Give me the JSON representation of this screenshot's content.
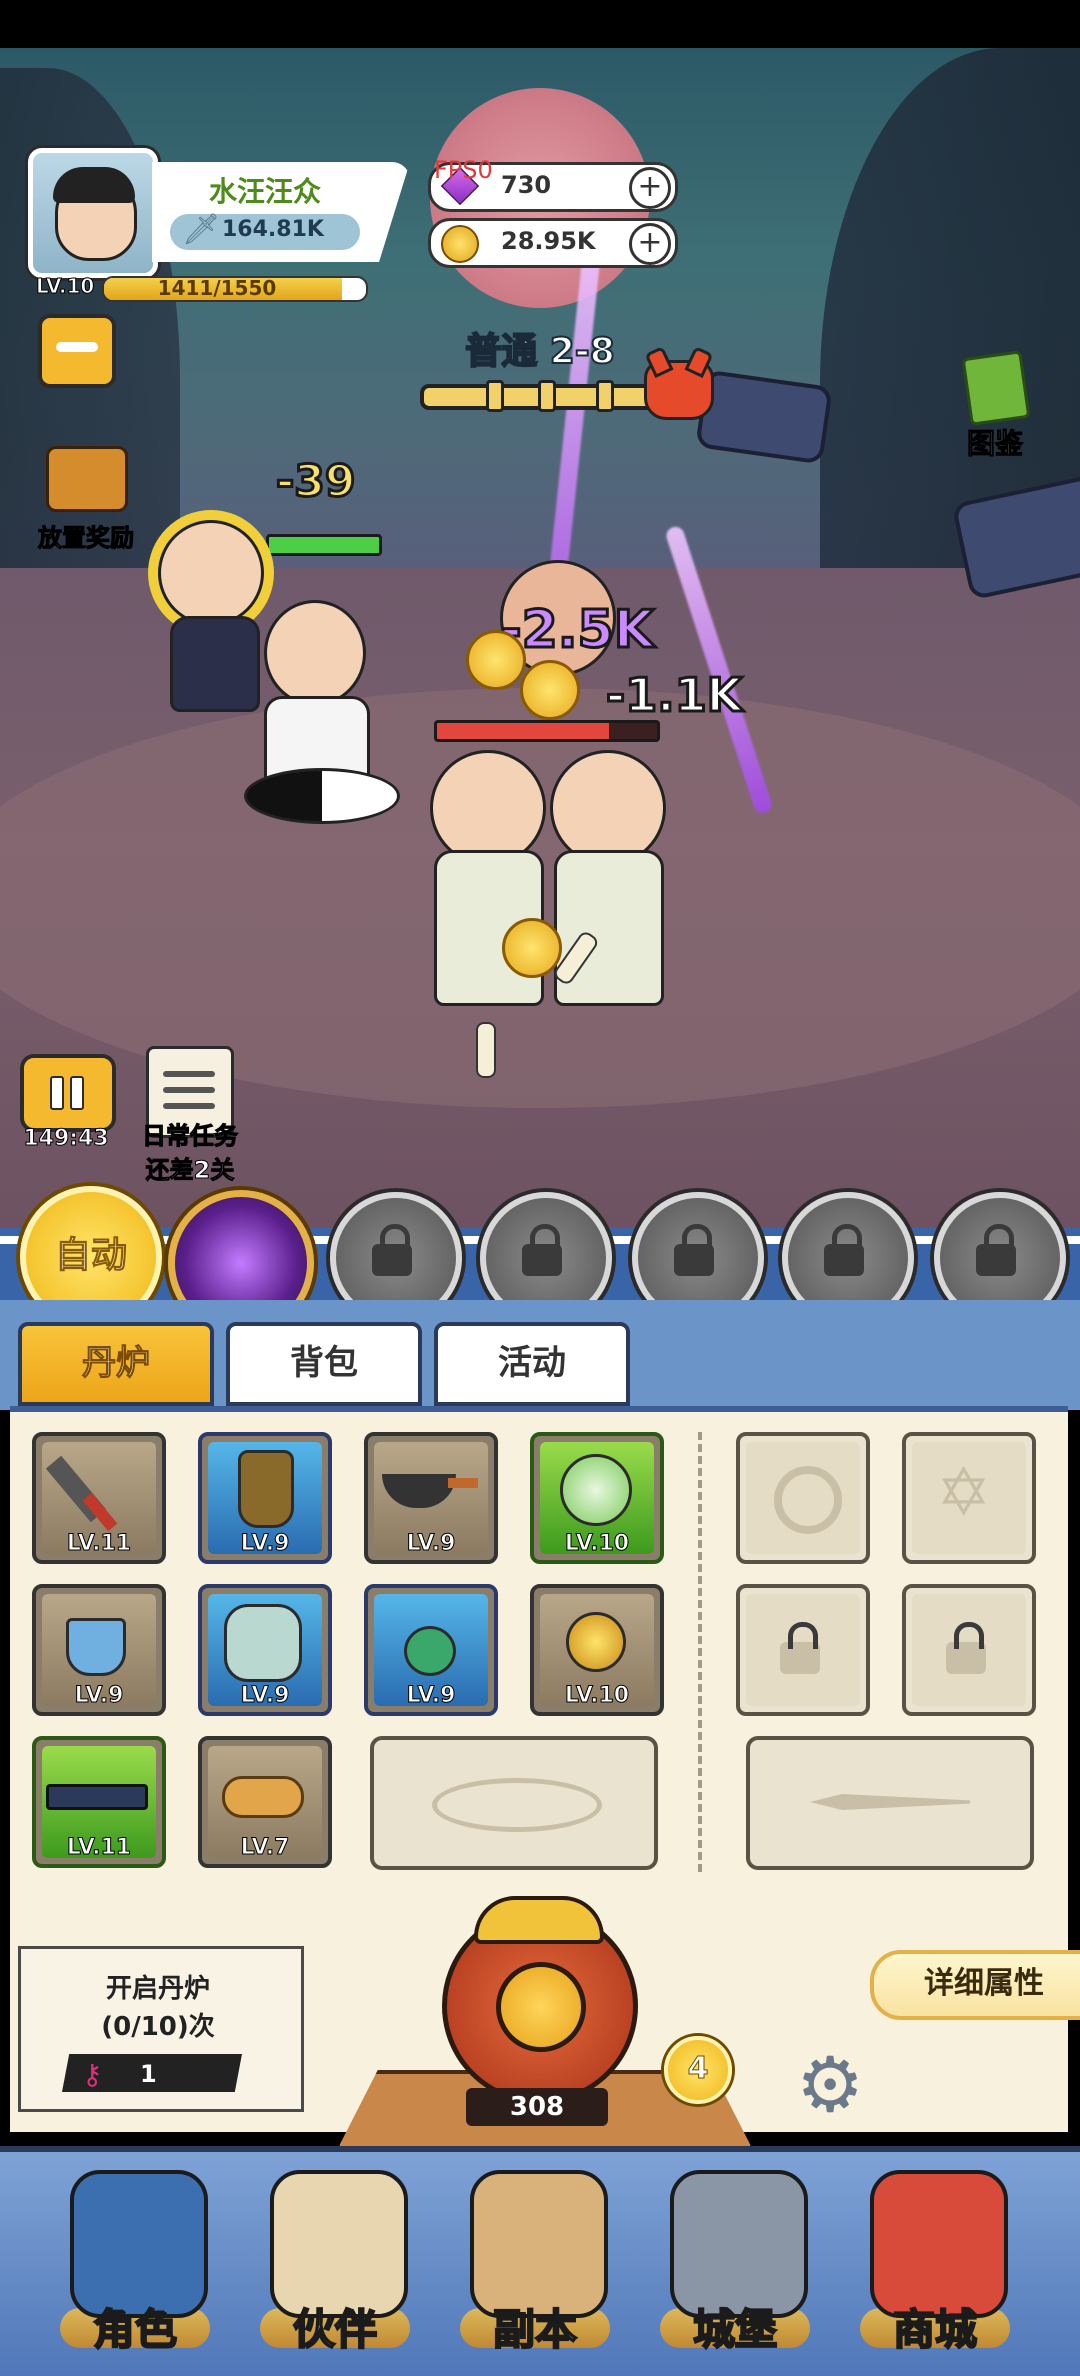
{
  "player": {
    "name": "水汪汪众",
    "power": "164.81K",
    "level": "LV.10",
    "exp": "1411/1550",
    "exp_fraction": 0.91
  },
  "resources": {
    "gems": "730",
    "coins": "28.95K",
    "fps_label": "FPS0"
  },
  "stage": {
    "title": "普通 2-8"
  },
  "side_buttons": {
    "idle_reward": "放置奖励",
    "codex": "图鉴",
    "timer": "149:43",
    "daily_task": "日常任务",
    "daily_task_sub": "还差2关"
  },
  "battle": {
    "damage_player": "-39",
    "damage_big": "-2.5K",
    "damage_enemy": "-1.1K",
    "player_hp_fraction": 1.0,
    "enemy_hp_fraction": 0.78
  },
  "skills": {
    "auto_label": "自动"
  },
  "tabs": [
    {
      "label": "丹炉",
      "active": true
    },
    {
      "label": "背包",
      "active": false
    },
    {
      "label": "活动",
      "active": false
    }
  ],
  "equipment": [
    {
      "level": "LV.11",
      "icon": "spatula-icon",
      "rarity": "brown"
    },
    {
      "level": "LV.9",
      "icon": "armor-icon",
      "rarity": "blue"
    },
    {
      "level": "LV.9",
      "icon": "wok-icon",
      "rarity": "brown"
    },
    {
      "level": "LV.10",
      "icon": "spirit-orb-icon",
      "rarity": "green"
    },
    {
      "level": "LV.9",
      "icon": "teacup-icon",
      "rarity": "brown"
    },
    {
      "level": "LV.9",
      "icon": "jade-disc-icon",
      "rarity": "blue"
    },
    {
      "level": "LV.9",
      "icon": "amulet-icon",
      "rarity": "blue"
    },
    {
      "level": "LV.10",
      "icon": "golden-pearl-icon",
      "rarity": "brown"
    },
    {
      "level": "LV.11",
      "icon": "belt-icon",
      "rarity": "green"
    },
    {
      "level": "LV.7",
      "icon": "sandals-icon",
      "rarity": "brown"
    }
  ],
  "forge": {
    "open_label": "开启丹炉",
    "count_label": "(0/10)次",
    "keys": "1",
    "total": "308",
    "level": "4",
    "detail_label": "详细属性"
  },
  "nav": [
    {
      "label": "角色",
      "icon": "character-icon"
    },
    {
      "label": "伙伴",
      "icon": "partner-icon"
    },
    {
      "label": "副本",
      "icon": "dungeon-icon"
    },
    {
      "label": "城堡",
      "icon": "castle-icon"
    },
    {
      "label": "商城",
      "icon": "shop-icon"
    }
  ],
  "colors": {
    "accent_gold": "#f4b92e",
    "panel_bg": "#f7f1dd",
    "nav_blue": "#4f76b8",
    "player_name": "#4f8a1c"
  }
}
